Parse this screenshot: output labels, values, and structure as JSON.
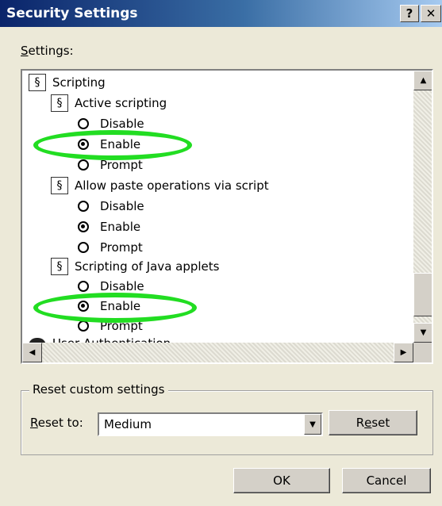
{
  "window": {
    "title": "Security Settings",
    "help_glyph": "?",
    "close_glyph": "✕"
  },
  "settings_label": {
    "first": "S",
    "rest": "ettings:"
  },
  "tree": {
    "scripting": "Scripting",
    "active_scripting": "Active scripting",
    "active_options": [
      "Disable",
      "Enable",
      "Prompt"
    ],
    "paste_via_script": "Allow paste operations via script",
    "paste_options": [
      "Disable",
      "Enable",
      "Prompt"
    ],
    "java_applets": "Scripting of Java applets",
    "java_options": [
      "Disable",
      "Enable",
      "Prompt"
    ],
    "user_auth": "User Authentication",
    "selected": {
      "active_scripting": "Enable",
      "paste_via_script": "Enable",
      "java_applets": "Enable"
    },
    "icon_glyph": "§"
  },
  "scroll": {
    "up": "▲",
    "down": "▼",
    "left": "◀",
    "right": "▶"
  },
  "reset_group": {
    "legend": "Reset custom settings",
    "reset_to_first": "R",
    "reset_to_rest": "eset to:",
    "level_value": "Medium",
    "combo_arrow": "▼",
    "reset_pre": "R",
    "reset_u": "e",
    "reset_post": "set"
  },
  "buttons": {
    "ok": "OK",
    "cancel": "Cancel"
  },
  "colors": {
    "highlight": "#22dd22",
    "title_bar": "#0a246a"
  }
}
